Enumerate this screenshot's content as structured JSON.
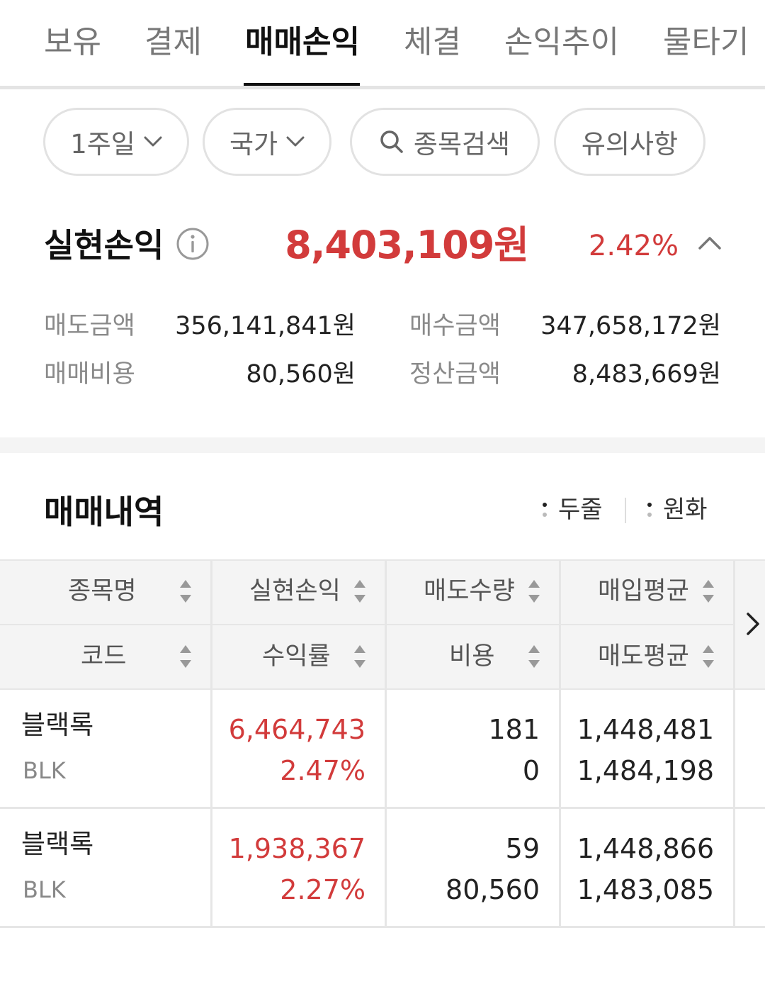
{
  "tabs": [
    {
      "label": "보유"
    },
    {
      "label": "결제"
    },
    {
      "label": "매매손익",
      "active": true
    },
    {
      "label": "체결"
    },
    {
      "label": "손익추이"
    },
    {
      "label": "물타기"
    }
  ],
  "filters": {
    "period": "1주일",
    "country": "국가",
    "search": "종목검색",
    "notice": "유의사항"
  },
  "summary": {
    "label": "실현손익",
    "value": "8,403,109원",
    "rate": "2.42%",
    "sell_amount_label": "매도금액",
    "sell_amount": "356,141,841원",
    "buy_amount_label": "매수금액",
    "buy_amount": "347,658,172원",
    "fee_label": "매매비용",
    "fee": "80,560원",
    "settle_label": "정산금액",
    "settle": "8,483,669원"
  },
  "history": {
    "title": "매매내역",
    "option_lines": "두줄",
    "option_currency": "원화",
    "headers": {
      "name": "종목명",
      "pl": "실현손익",
      "sell_qty": "매도수량",
      "buy_avg": "매입평균",
      "code": "코드",
      "rate": "수익률",
      "fee": "비용",
      "sell_avg": "매도평균"
    },
    "rows": [
      {
        "name": "블랙록",
        "code": "BLK",
        "pl": "6,464,743",
        "rate": "2.47%",
        "sell_qty": "181",
        "fee": "0",
        "buy_avg": "1,448,481",
        "sell_avg": "1,484,198"
      },
      {
        "name": "블랙록",
        "code": "BLK",
        "pl": "1,938,367",
        "rate": "2.27%",
        "sell_qty": "59",
        "fee": "80,560",
        "buy_avg": "1,448,866",
        "sell_avg": "1,483,085"
      }
    ]
  },
  "colors": {
    "profit_red": "#d23b3b",
    "label_gray": "#8a8a8a",
    "header_bg": "#f4f4f4"
  },
  "icons": {
    "info": "info-circle-icon",
    "collapse": "chevron-up-icon",
    "dropdown": "chevron-down-icon",
    "search": "search-icon",
    "sort": "sort-icon",
    "scroll_right": "chevron-right-icon"
  }
}
